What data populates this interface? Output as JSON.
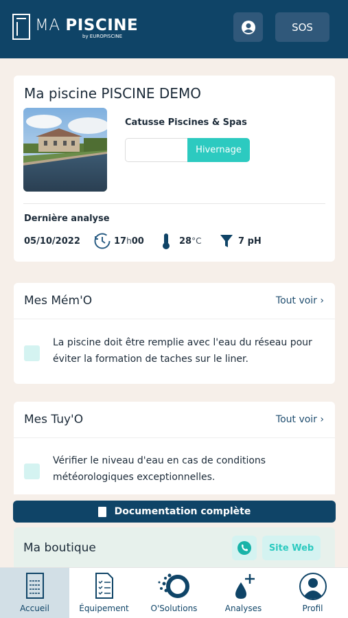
{
  "header": {
    "logo_main": "MA ",
    "logo_bold": "PISCINE",
    "logo_sub": "by EUROPISCINE",
    "sos_label": "SOS",
    "user_icon": "user-circle-icon"
  },
  "pool": {
    "title": "Ma piscine PISCINE DEMO",
    "dealer": "Catusse Piscines & Spas",
    "winter_label": "Hivernage",
    "last_analysis_label": "Dernière analyse",
    "date": "05/10/2022",
    "time_h": "17",
    "time_sep": "h",
    "time_m": "00",
    "temp_value": "28",
    "temp_unit": "°C",
    "ph": "7 pH"
  },
  "memo": {
    "title": "Mes Mém'O",
    "see_all": "Tout voir ›",
    "item": "La piscine doit être remplie avec l'eau du réseau pour éviter la formation de taches sur le liner."
  },
  "tuyo": {
    "title": "Mes Tuy'O",
    "see_all": "Tout voir ›",
    "item": "Vérifier le niveau d'eau en cas de conditions météorologiques exceptionnelles."
  },
  "doc_button": "Documentation complète",
  "shop": {
    "title": "Ma boutique",
    "site_web": "Site Web"
  },
  "tabs": [
    {
      "label": "Accueil",
      "active": true
    },
    {
      "label": "Équipement",
      "active": false
    },
    {
      "label": "O'Solutions",
      "active": false
    },
    {
      "label": "Analyses",
      "active": false
    },
    {
      "label": "Profil",
      "active": false
    }
  ],
  "colors": {
    "primary": "#0f4467",
    "accent": "#2ccac0",
    "background": "#f6efe9"
  }
}
